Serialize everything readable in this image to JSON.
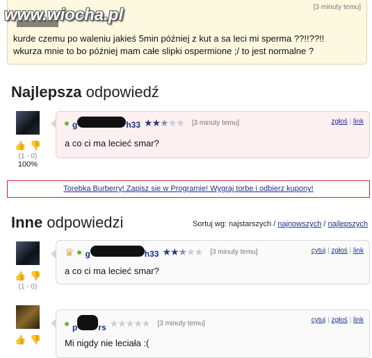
{
  "watermark": "www.wiocha.pl",
  "question": {
    "time": "[3 minuty temu]",
    "line1": "kurde czemu po waleniu jakieś 5min później z kut a sa leci mi sperma ??!!??!!",
    "line2": "wkurza mnie to bo później mam całe slipki ospermione ;/ to jest normalne ?"
  },
  "best_section": {
    "bold": "Najlepsza",
    "rest": " odpowiedź"
  },
  "other_section": {
    "bold": "Inne",
    "rest": " odpowiedzi"
  },
  "sort": {
    "label": "Sortuj wg: najstarszych / ",
    "newest": "najnowszych",
    "sep": " / ",
    "best": "najlepszych"
  },
  "actions": {
    "quote": "cytuj",
    "report": "zgłoś",
    "link": "link",
    "divider": "|"
  },
  "promo": "Torebka Burberry! Zapisz sie w Programie! Wygraj torbe i odbierz kupony!",
  "answers": {
    "best": {
      "user_prefix": "g",
      "user_suffix": "h33",
      "rating": 2.5,
      "time": "[3 minuty temu]",
      "text": "a co ci ma lecieć smar?",
      "count": "(1 - 0)",
      "percent": "100%"
    },
    "first": {
      "user_prefix": "g",
      "user_suffix": "h33",
      "rating": 2.5,
      "time": "[3 minuty temu]",
      "text": "a co ci ma lecieć smar?",
      "count": "(1 - 0)",
      "percent": ""
    },
    "second": {
      "user_prefix": "p",
      "user_suffix": "rs",
      "rating": 0,
      "time": "[3 minuty temu]",
      "text": "Mi nigdy nie leciała :(",
      "count": "",
      "percent": ""
    }
  },
  "icons": {
    "thumb_up": "thumb-up-icon",
    "thumb_down": "thumb-down-icon",
    "crown": "crown-icon",
    "online": "online-dot-icon"
  },
  "colors": {
    "link": "#1a2f8f",
    "promo_border": "#c7242d",
    "online": "#67b633",
    "star_on": "#2c3a7c"
  }
}
